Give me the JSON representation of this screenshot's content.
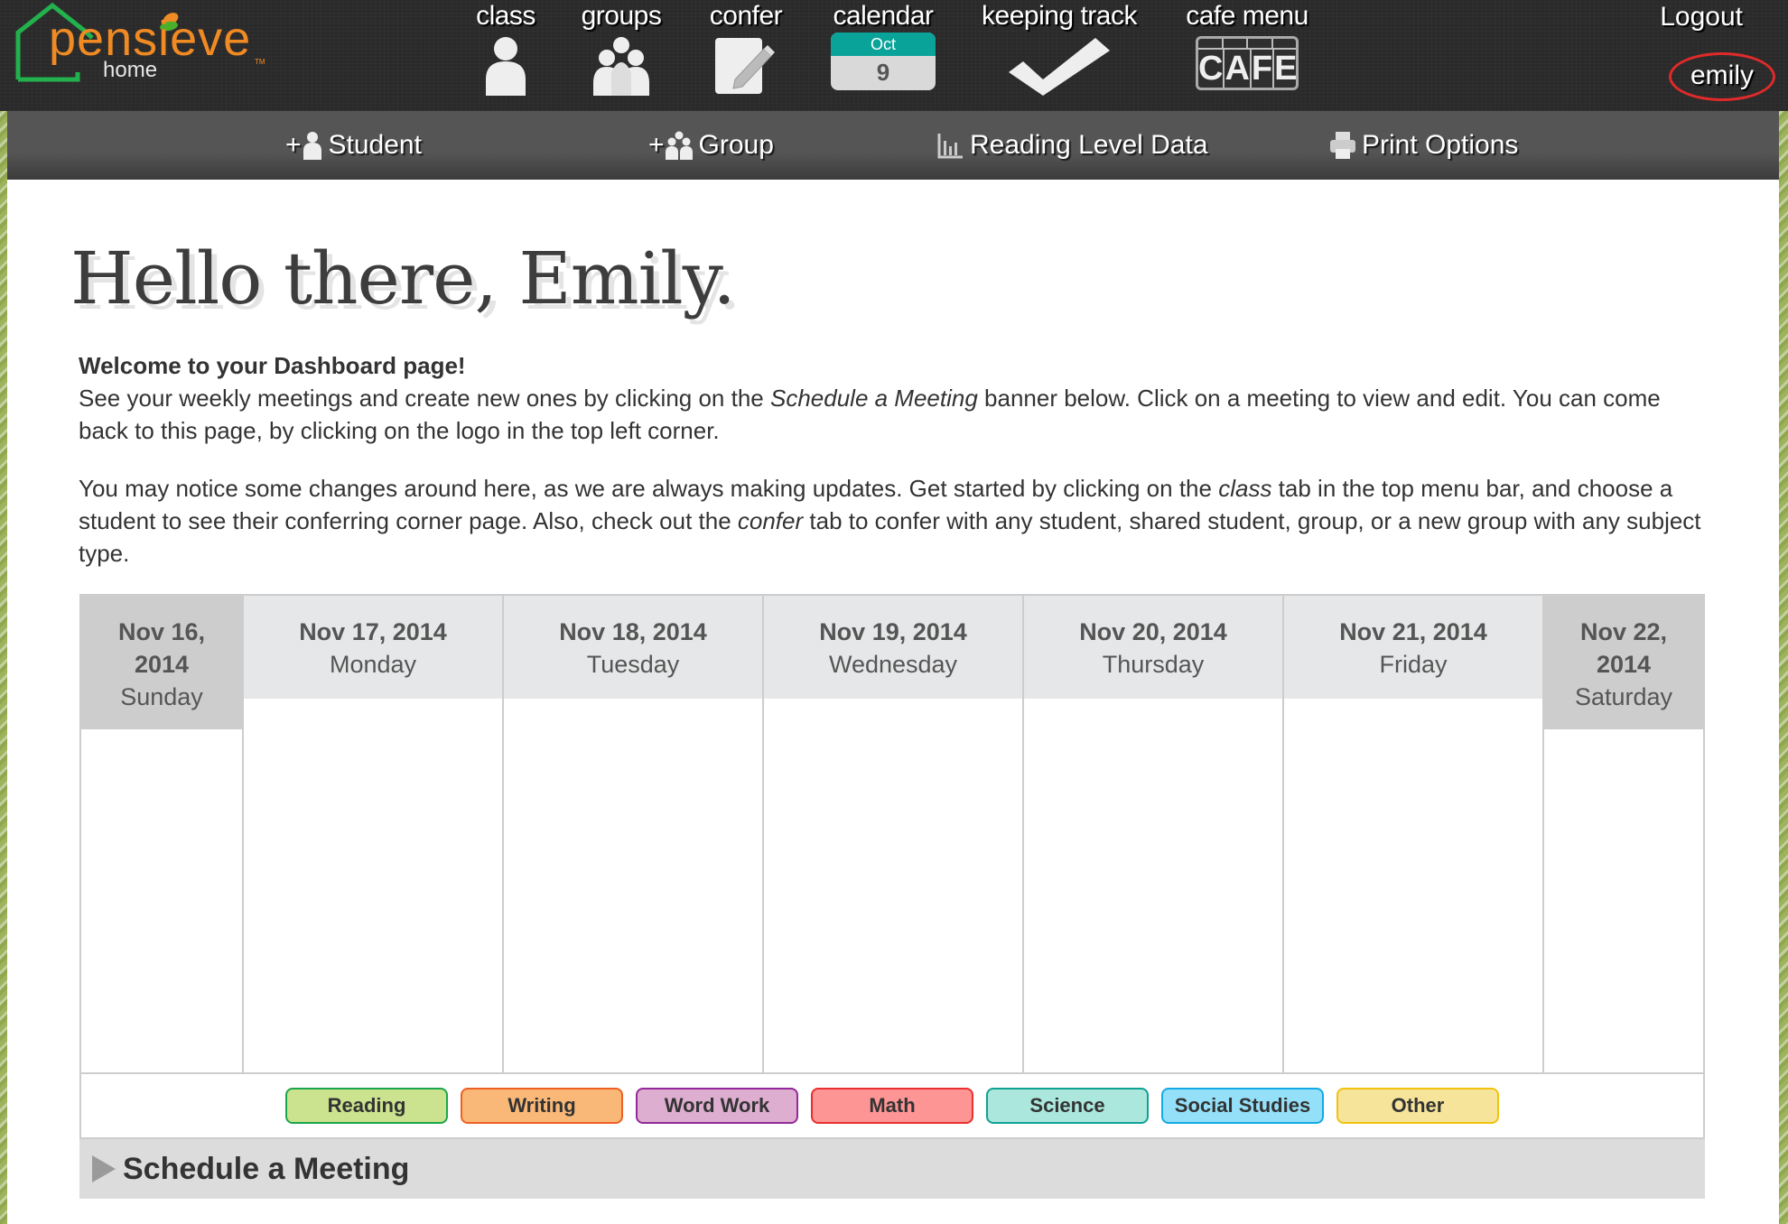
{
  "logo": {
    "word": "pensieve",
    "sub": "home",
    "tm": "TM"
  },
  "nav": [
    {
      "label": "class",
      "icon": "person-icon"
    },
    {
      "label": "groups",
      "icon": "group-icon"
    },
    {
      "label": "confer",
      "icon": "notepad-pencil-icon"
    },
    {
      "label": "calendar",
      "icon": "calendar-icon",
      "month": "Oct",
      "day": "9"
    },
    {
      "label": "keeping track",
      "icon": "checkmark-icon"
    },
    {
      "label": "cafe menu",
      "icon": "cafe-sign-icon",
      "letters": [
        "C",
        "A",
        "F",
        "E"
      ]
    }
  ],
  "user": {
    "logout": "Logout",
    "name": "emily"
  },
  "toolbar": [
    {
      "prefix": "+",
      "label": "Student",
      "icon": "add-student-icon"
    },
    {
      "prefix": "+",
      "label": "Group",
      "icon": "add-group-icon"
    },
    {
      "prefix": "",
      "label": "Reading Level Data",
      "icon": "bar-chart-icon"
    },
    {
      "prefix": "",
      "label": "Print Options",
      "icon": "printer-icon"
    }
  ],
  "greeting": "Hello there, Emily.",
  "intro": {
    "heading": "Welcome to your Dashboard page!",
    "p1_a": "See your weekly meetings and create new ones by clicking on the ",
    "p1_em": "Schedule a Meeting",
    "p1_b": " banner below. Click on a meeting to view and edit. You can come back to this page, by clicking on the logo in the top left corner.",
    "p2_a": "You may notice some changes around here, as we are always making updates. Get started by clicking on the ",
    "p2_em1": "class",
    "p2_b": " tab in the top menu bar, and choose a student to see their conferring corner page. Also, check out the ",
    "p2_em2": "confer",
    "p2_c": " tab to confer with any student, shared student, group, or a new group with any subject type."
  },
  "calendar": {
    "days": [
      {
        "date": "Nov 16, 2014",
        "name": "Sunday",
        "weekend": true
      },
      {
        "date": "Nov 17, 2014",
        "name": "Monday",
        "weekend": false
      },
      {
        "date": "Nov 18, 2014",
        "name": "Tuesday",
        "weekend": false
      },
      {
        "date": "Nov 19, 2014",
        "name": "Wednesday",
        "weekend": false
      },
      {
        "date": "Nov 20, 2014",
        "name": "Thursday",
        "weekend": false
      },
      {
        "date": "Nov 21, 2014",
        "name": "Friday",
        "weekend": false
      },
      {
        "date": "Nov 22, 2014",
        "name": "Saturday",
        "weekend": true
      }
    ]
  },
  "legend": [
    {
      "label": "Reading",
      "bg": "#cbe28f",
      "border": "#1aa64b"
    },
    {
      "label": "Writing",
      "bg": "#f9b877",
      "border": "#ee5f23"
    },
    {
      "label": "Word Work",
      "bg": "#ddaed0",
      "border": "#93299a"
    },
    {
      "label": "Math",
      "bg": "#fd9595",
      "border": "#e8302f"
    },
    {
      "label": "Science",
      "bg": "#abe7dc",
      "border": "#10a195"
    },
    {
      "label": "Social Studies",
      "bg": "#94e0f9",
      "border": "#12a9e6"
    },
    {
      "label": "Other",
      "bg": "#f5e49a",
      "border": "#f1c20e"
    }
  ],
  "schedule": {
    "label": "Schedule a Meeting"
  },
  "colors": {
    "accent_teal": "#0aa39a",
    "logo_orange": "#f08a24",
    "logo_green": "#22b14c",
    "highlight_red": "#e02a2a"
  }
}
